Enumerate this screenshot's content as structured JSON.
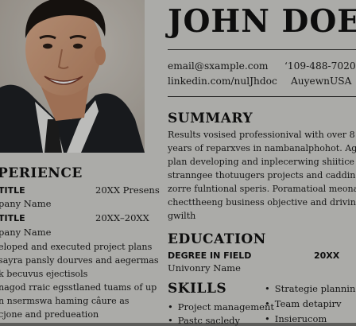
{
  "header": {
    "name": "JOHN DOE",
    "email": "email@sxample.com",
    "phone": "ʻ109-488-7020",
    "linkedin": "linkedin.com/nulJhdoc",
    "location": "AuyewnUSA"
  },
  "photo": {
    "icon": "portrait-photo"
  },
  "experience": {
    "title": "PERIENCE",
    "jobs": [
      {
        "title": "TITLE",
        "dates": "20XX Presens",
        "company": "pany Name"
      },
      {
        "title": "TITLE",
        "dates": "20XX–20XX",
        "company": "pany Name"
      }
    ],
    "lines": [
      "eloped and executed project plans",
      "sayra pansly dourves and aegermas",
      "k becuvus ejectisols",
      "nagod rraic egsstlaned tuams of up",
      "n nsermswa haming câure as",
      "cjone and predueation"
    ]
  },
  "summary": {
    "title": "SUMMARY",
    "lines": [
      "Results vosised professionival with over 8",
      "years of reparxves in nambanalphohot. Aga",
      "plan developing and inplecerwing shiitice",
      "stranngee thotuugers projects and cadding",
      "zorre fulntional speris. Poramatioal meona",
      "checttheeng business objective and driving",
      "gwilth"
    ]
  },
  "education": {
    "title": "EDUCATION",
    "degree": "DEGREE IN FIELD",
    "year": "20XX",
    "school": "Univonry Name"
  },
  "skills": {
    "title": "SKILLS",
    "col1": [
      "Project management",
      "Pastc sacledy"
    ],
    "col2": [
      "Strategie planning",
      "Team detapirv",
      "Insierucom"
    ]
  },
  "colors": {
    "page": "#dcdcd8",
    "text": "#151515",
    "overlay": "#000000"
  }
}
